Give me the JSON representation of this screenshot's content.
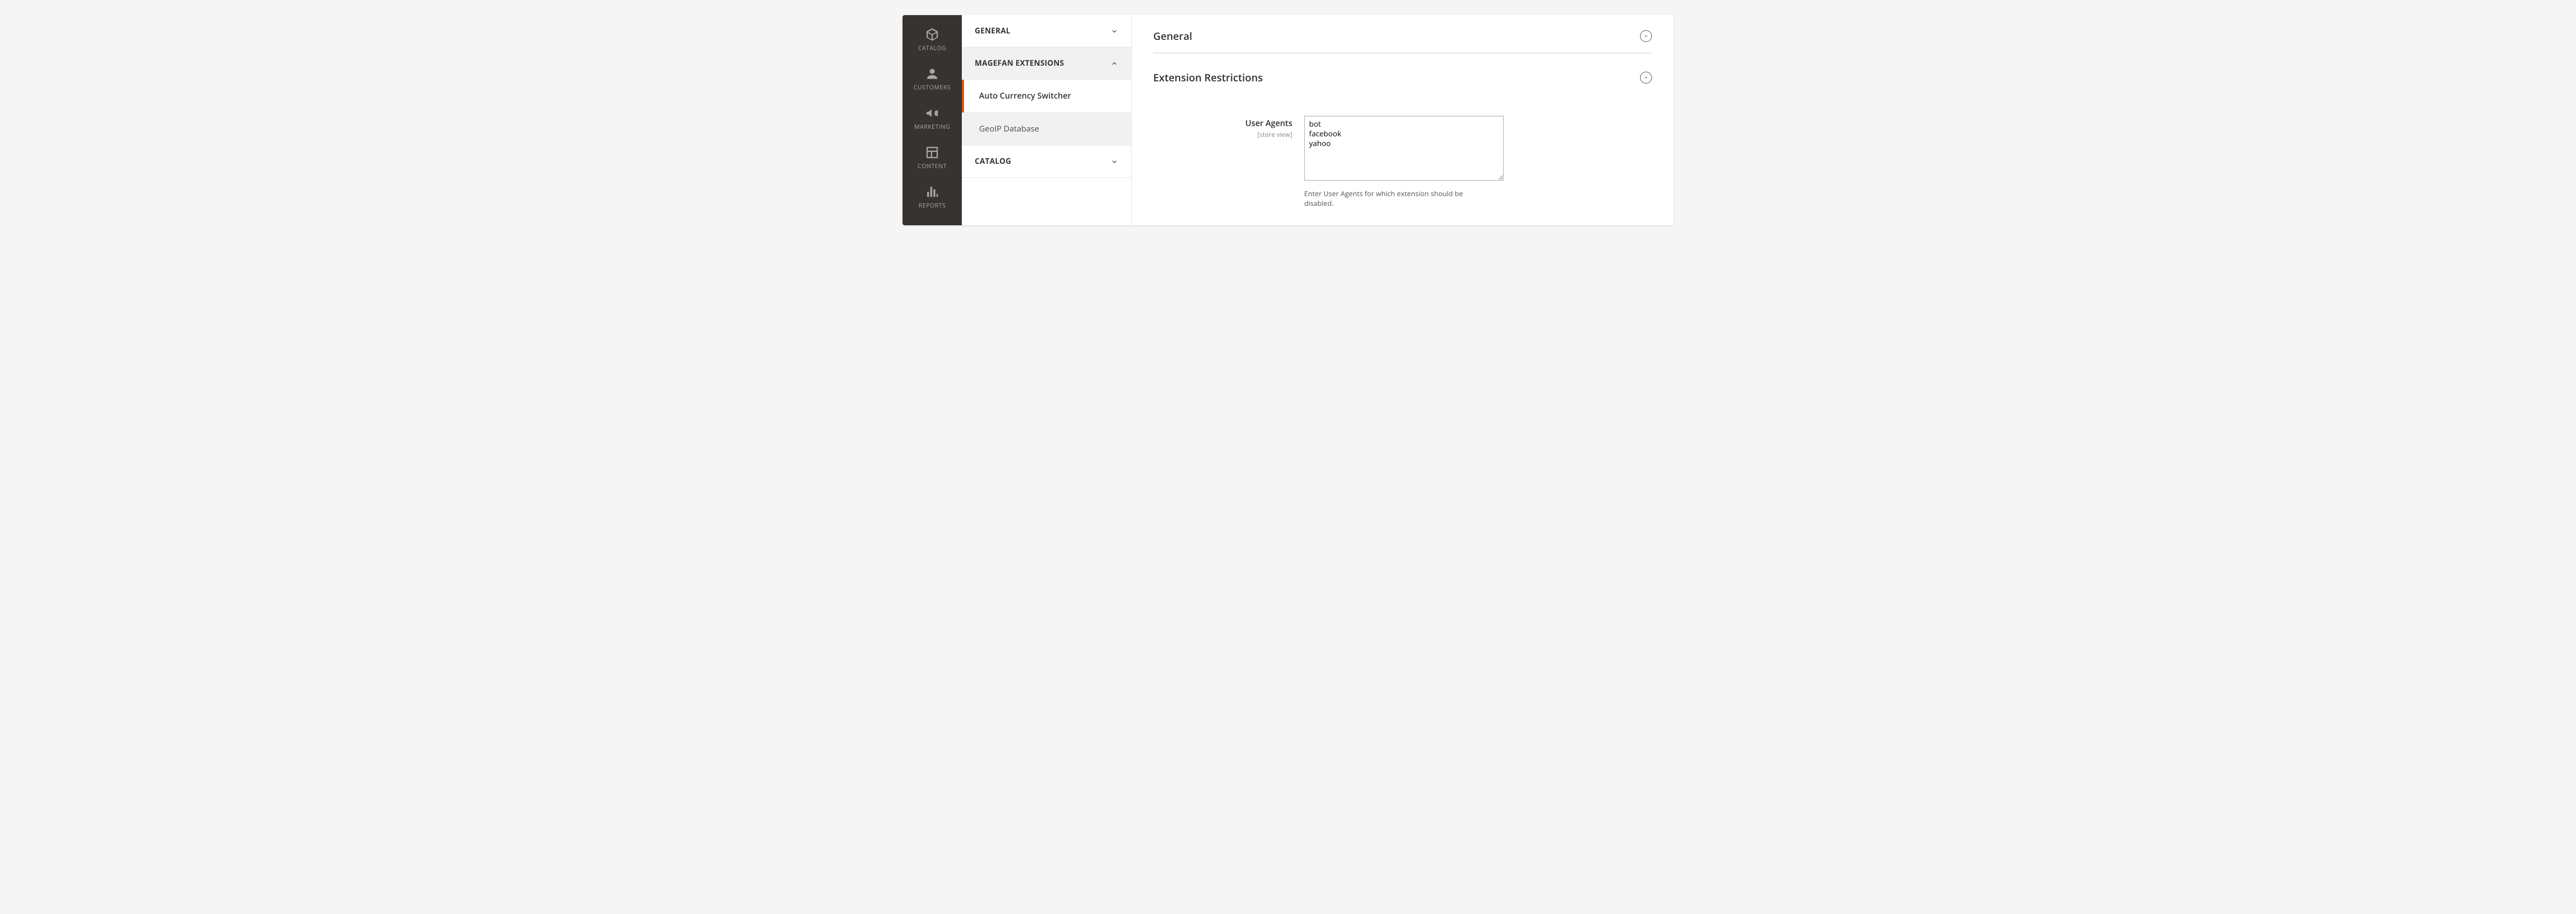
{
  "nav": [
    {
      "id": "catalog",
      "label": "CATALOG",
      "icon": "cube"
    },
    {
      "id": "customers",
      "label": "CUSTOMERS",
      "icon": "person"
    },
    {
      "id": "marketing",
      "label": "MARKETING",
      "icon": "megaphone"
    },
    {
      "id": "content",
      "label": "CONTENT",
      "icon": "layout"
    },
    {
      "id": "reports",
      "label": "REPORTS",
      "icon": "chart"
    }
  ],
  "tree": {
    "sections": [
      {
        "label": "GENERAL",
        "expanded": false
      },
      {
        "label": "MAGEFAN EXTENSIONS",
        "expanded": true,
        "items": [
          {
            "label": "Auto Currency Switcher",
            "active": true
          },
          {
            "label": "GeoIP Database",
            "active": false
          }
        ]
      },
      {
        "label": "CATALOG",
        "expanded": false
      }
    ]
  },
  "content": {
    "sections": [
      {
        "title": "General",
        "collapsed": true
      },
      {
        "title": "Extension Restrictions",
        "collapsed": false
      }
    ],
    "field": {
      "label": "User Agents",
      "scope": "[store view]",
      "value": "bot\nfacebook\nyahoo",
      "note": "Enter User Agents for which extension should be disabled."
    }
  }
}
